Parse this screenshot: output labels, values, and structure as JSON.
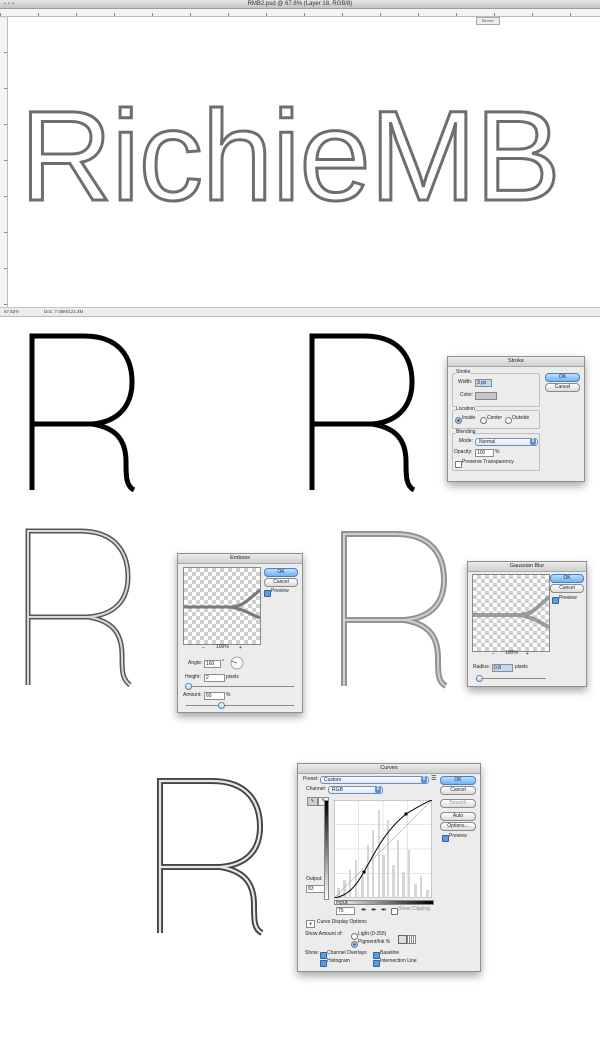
{
  "window": {
    "title": "RMB2.psd @ 67.8% (Layer 18, RGB/8)",
    "panel_tab": "Blur/sv",
    "status_zoom": "67.82%",
    "status_doc": "Doc: 7.08M/121.4M"
  },
  "canvas": {
    "text": "RichieMB",
    "stroke_color": "#6e6e6e"
  },
  "letter": "R",
  "stroke_dialog": {
    "title": "Stroke",
    "group_label": "Stroke",
    "width_label": "Width:",
    "width_value": "3 px",
    "color_label": "Color:",
    "location_label": "Location",
    "location_options": [
      "Inside",
      "Center",
      "Outside"
    ],
    "blending_label": "Blending",
    "mode_label": "Mode:",
    "mode_value": "Normal",
    "opacity_label": "Opacity:",
    "opacity_value": "100",
    "opacity_unit": "%",
    "preserve_label": "Preserve Transparency",
    "ok": "OK",
    "cancel": "Cancel"
  },
  "emboss_dialog": {
    "title": "Emboss",
    "ok": "OK",
    "cancel": "Cancel",
    "preview": "Preview",
    "zoom": "100%",
    "minus": "−",
    "plus": "+",
    "angle_label": "Angle:",
    "angle_value": "160",
    "angle_unit": "°",
    "height_label": "Height:",
    "height_value": "2",
    "height_unit": "pixels",
    "amount_label": "Amount:",
    "amount_value": "60",
    "amount_unit": "%"
  },
  "blur_dialog": {
    "title": "Gaussian Blur",
    "ok": "OK",
    "cancel": "Cancel",
    "preview": "Preview",
    "zoom": "100%",
    "minus": "−",
    "plus": "+",
    "radius_label": "Radius:",
    "radius_value": "0.8",
    "radius_unit": "pixels"
  },
  "curves_dialog": {
    "title": "Curves",
    "preset_label": "Preset:",
    "preset_value": "Custom",
    "channel_label": "Channel:",
    "channel_value": "RGB",
    "ok": "OK",
    "cancel": "Cancel",
    "smooth": "Smooth",
    "auto": "Auto",
    "options": "Options...",
    "preview": "Preview",
    "output_label": "Output:",
    "output_value": "83",
    "input_label": "Input:",
    "input_value": "75",
    "show_clipping": "Show Clipping",
    "display_options": "Curve Display Options",
    "show_amount_label": "Show Amount of:",
    "light_option": "Light (0-255)",
    "pigment_option": "Pigment/Ink %",
    "show_label": "Show:",
    "channel_overlays": "Channel Overlays",
    "baseline": "Baseline",
    "histogram": "Histogram",
    "intersection_line": "Intersection Line"
  }
}
